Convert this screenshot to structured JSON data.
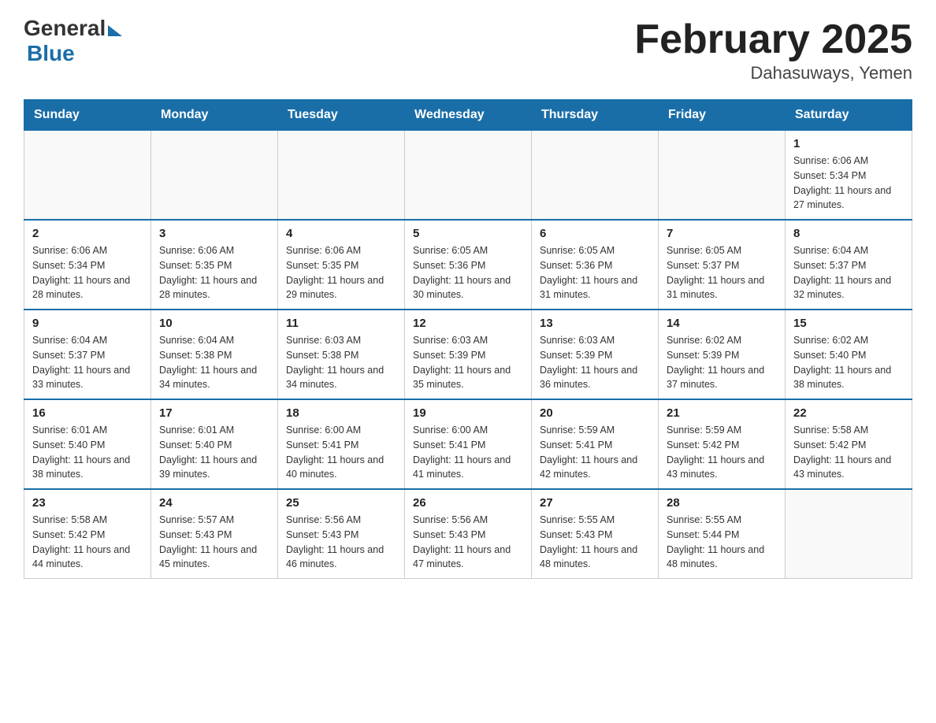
{
  "header": {
    "title": "February 2025",
    "subtitle": "Dahasuways, Yemen",
    "logo_general": "General",
    "logo_blue": "Blue"
  },
  "weekdays": [
    "Sunday",
    "Monday",
    "Tuesday",
    "Wednesday",
    "Thursday",
    "Friday",
    "Saturday"
  ],
  "weeks": [
    {
      "days": [
        {
          "number": "",
          "info": ""
        },
        {
          "number": "",
          "info": ""
        },
        {
          "number": "",
          "info": ""
        },
        {
          "number": "",
          "info": ""
        },
        {
          "number": "",
          "info": ""
        },
        {
          "number": "",
          "info": ""
        },
        {
          "number": "1",
          "info": "Sunrise: 6:06 AM\nSunset: 5:34 PM\nDaylight: 11 hours and 27 minutes."
        }
      ]
    },
    {
      "days": [
        {
          "number": "2",
          "info": "Sunrise: 6:06 AM\nSunset: 5:34 PM\nDaylight: 11 hours and 28 minutes."
        },
        {
          "number": "3",
          "info": "Sunrise: 6:06 AM\nSunset: 5:35 PM\nDaylight: 11 hours and 28 minutes."
        },
        {
          "number": "4",
          "info": "Sunrise: 6:06 AM\nSunset: 5:35 PM\nDaylight: 11 hours and 29 minutes."
        },
        {
          "number": "5",
          "info": "Sunrise: 6:05 AM\nSunset: 5:36 PM\nDaylight: 11 hours and 30 minutes."
        },
        {
          "number": "6",
          "info": "Sunrise: 6:05 AM\nSunset: 5:36 PM\nDaylight: 11 hours and 31 minutes."
        },
        {
          "number": "7",
          "info": "Sunrise: 6:05 AM\nSunset: 5:37 PM\nDaylight: 11 hours and 31 minutes."
        },
        {
          "number": "8",
          "info": "Sunrise: 6:04 AM\nSunset: 5:37 PM\nDaylight: 11 hours and 32 minutes."
        }
      ]
    },
    {
      "days": [
        {
          "number": "9",
          "info": "Sunrise: 6:04 AM\nSunset: 5:37 PM\nDaylight: 11 hours and 33 minutes."
        },
        {
          "number": "10",
          "info": "Sunrise: 6:04 AM\nSunset: 5:38 PM\nDaylight: 11 hours and 34 minutes."
        },
        {
          "number": "11",
          "info": "Sunrise: 6:03 AM\nSunset: 5:38 PM\nDaylight: 11 hours and 34 minutes."
        },
        {
          "number": "12",
          "info": "Sunrise: 6:03 AM\nSunset: 5:39 PM\nDaylight: 11 hours and 35 minutes."
        },
        {
          "number": "13",
          "info": "Sunrise: 6:03 AM\nSunset: 5:39 PM\nDaylight: 11 hours and 36 minutes."
        },
        {
          "number": "14",
          "info": "Sunrise: 6:02 AM\nSunset: 5:39 PM\nDaylight: 11 hours and 37 minutes."
        },
        {
          "number": "15",
          "info": "Sunrise: 6:02 AM\nSunset: 5:40 PM\nDaylight: 11 hours and 38 minutes."
        }
      ]
    },
    {
      "days": [
        {
          "number": "16",
          "info": "Sunrise: 6:01 AM\nSunset: 5:40 PM\nDaylight: 11 hours and 38 minutes."
        },
        {
          "number": "17",
          "info": "Sunrise: 6:01 AM\nSunset: 5:40 PM\nDaylight: 11 hours and 39 minutes."
        },
        {
          "number": "18",
          "info": "Sunrise: 6:00 AM\nSunset: 5:41 PM\nDaylight: 11 hours and 40 minutes."
        },
        {
          "number": "19",
          "info": "Sunrise: 6:00 AM\nSunset: 5:41 PM\nDaylight: 11 hours and 41 minutes."
        },
        {
          "number": "20",
          "info": "Sunrise: 5:59 AM\nSunset: 5:41 PM\nDaylight: 11 hours and 42 minutes."
        },
        {
          "number": "21",
          "info": "Sunrise: 5:59 AM\nSunset: 5:42 PM\nDaylight: 11 hours and 43 minutes."
        },
        {
          "number": "22",
          "info": "Sunrise: 5:58 AM\nSunset: 5:42 PM\nDaylight: 11 hours and 43 minutes."
        }
      ]
    },
    {
      "days": [
        {
          "number": "23",
          "info": "Sunrise: 5:58 AM\nSunset: 5:42 PM\nDaylight: 11 hours and 44 minutes."
        },
        {
          "number": "24",
          "info": "Sunrise: 5:57 AM\nSunset: 5:43 PM\nDaylight: 11 hours and 45 minutes."
        },
        {
          "number": "25",
          "info": "Sunrise: 5:56 AM\nSunset: 5:43 PM\nDaylight: 11 hours and 46 minutes."
        },
        {
          "number": "26",
          "info": "Sunrise: 5:56 AM\nSunset: 5:43 PM\nDaylight: 11 hours and 47 minutes."
        },
        {
          "number": "27",
          "info": "Sunrise: 5:55 AM\nSunset: 5:43 PM\nDaylight: 11 hours and 48 minutes."
        },
        {
          "number": "28",
          "info": "Sunrise: 5:55 AM\nSunset: 5:44 PM\nDaylight: 11 hours and 48 minutes."
        },
        {
          "number": "",
          "info": ""
        }
      ]
    }
  ]
}
